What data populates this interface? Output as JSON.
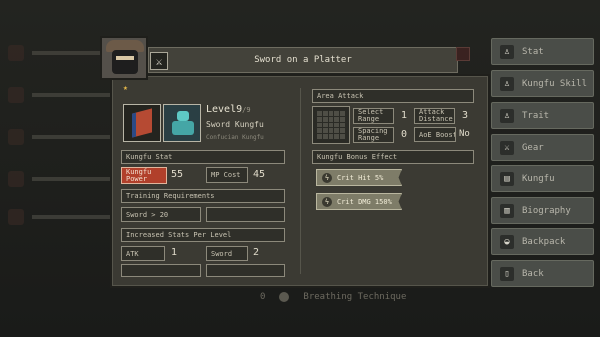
{
  "background": {
    "bottom_bar": {
      "count": "0",
      "label": "Breathing Technique"
    }
  },
  "side_menu": [
    {
      "label": "Stat",
      "icon": "person-icon"
    },
    {
      "label": "Kungfu Skill",
      "icon": "person-icon"
    },
    {
      "label": "Trait",
      "icon": "person-icon"
    },
    {
      "label": "Gear",
      "icon": "sword-icon"
    },
    {
      "label": "Kungfu",
      "icon": "book-icon"
    },
    {
      "label": "Biography",
      "icon": "book-icon"
    },
    {
      "label": "Backpack",
      "icon": "bag-icon"
    },
    {
      "label": "Back",
      "icon": "door-icon"
    }
  ],
  "dialog": {
    "title": "Sword on a Platter",
    "level": "Level9",
    "level_max": "/9",
    "kungfu_name": "Sword Kungfu",
    "kungfu_school": "Confucian Kungfu",
    "kungfu_stat_label": "Kungfu Stat",
    "kungfu_power_label": "Kungfu Power",
    "kungfu_power_value": "55",
    "mp_cost_label": "MP Cost",
    "mp_cost_value": "45",
    "training_label": "Training Requirements",
    "training_req": "Sword > 20",
    "increased_label": "Increased Stats Per Level",
    "stat1_label": "ATK",
    "stat1_value": "1",
    "stat2_label": "Sword",
    "stat2_value": "2",
    "area_attack_label": "Area Attack",
    "select_range_label": "Select Range",
    "select_range_value": "1",
    "attack_distance_label": "Attack Distance",
    "attack_distance_value": "3",
    "spacing_range_label": "Spacing Range",
    "spacing_range_value": "0",
    "aoe_boost_label": "AoE Boost",
    "aoe_boost_value": "No",
    "bonus_label": "Kungfu Bonus Effect",
    "bonus1": "Crit Hit 5%",
    "bonus2": "Crit DMG 150%"
  },
  "colors": {
    "accent_red": "#b1402b",
    "star": "#e7b94a",
    "panel": "#3b3a33"
  }
}
